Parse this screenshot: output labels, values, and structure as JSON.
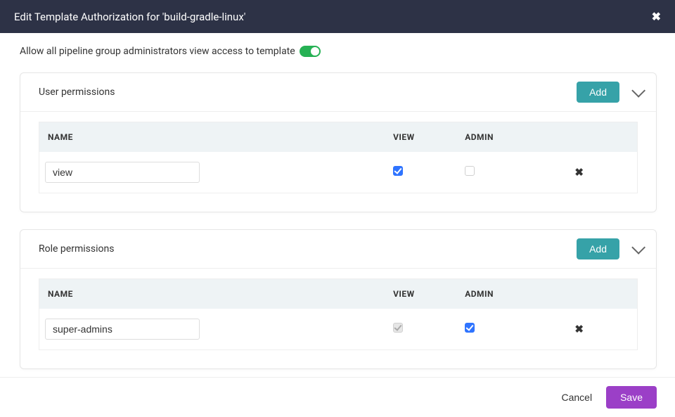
{
  "header": {
    "title": "Edit Template Authorization for 'build-gradle-linux'"
  },
  "allow_toggle": {
    "label": "Allow all pipeline group administrators view access to template",
    "on": true
  },
  "panels": {
    "user": {
      "title": "User permissions",
      "add_label": "Add",
      "columns": {
        "name": "NAME",
        "view": "VIEW",
        "admin": "ADMIN"
      },
      "rows": [
        {
          "name": "view",
          "view_checked": true,
          "view_disabled": false,
          "admin_checked": false,
          "admin_disabled": false
        }
      ]
    },
    "role": {
      "title": "Role permissions",
      "add_label": "Add",
      "columns": {
        "name": "NAME",
        "view": "VIEW",
        "admin": "ADMIN"
      },
      "rows": [
        {
          "name": "super-admins",
          "view_checked": true,
          "view_disabled": true,
          "admin_checked": true,
          "admin_disabled": false
        }
      ]
    }
  },
  "footer": {
    "cancel": "Cancel",
    "save": "Save"
  }
}
